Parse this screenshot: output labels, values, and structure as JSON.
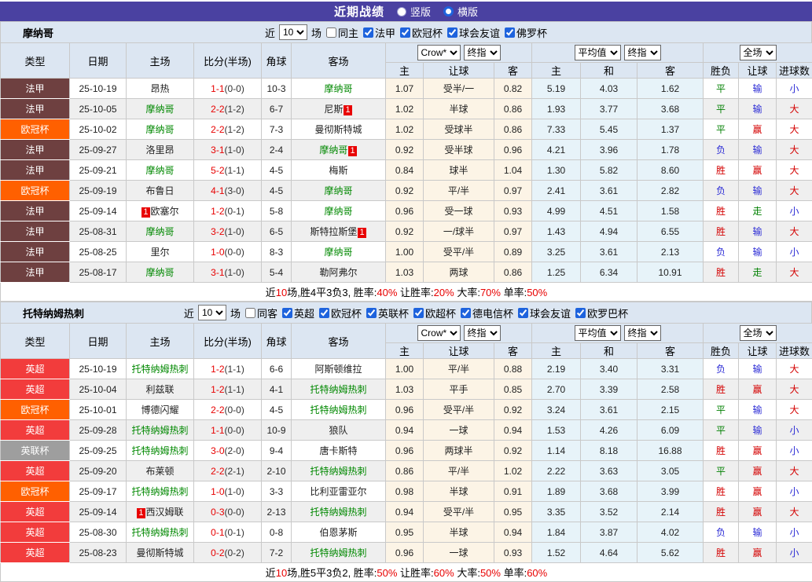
{
  "topbar": {
    "title": "近期战绩",
    "radio_vertical": "竖版",
    "radio_horizontal": "横版",
    "selected": "横版"
  },
  "table_headers": {
    "static": [
      "类型",
      "日期",
      "主场",
      "比分(半场)",
      "角球",
      "客场"
    ],
    "crow_select": "Crow*",
    "final_select": "终指",
    "avg_select": "平均值",
    "full_select": "全场",
    "sub": [
      "主",
      "让球",
      "客",
      "主",
      "和",
      "客",
      "胜负",
      "让球",
      "进球数"
    ]
  },
  "colors": {
    "topbar_bg": "#4a41a1",
    "panel_bg": "#dce6f2",
    "crow_bg": "#fcf4e6",
    "avg_bg": "#e7f3f9",
    "stripe_bg": "#efefef",
    "team_green": "#008800",
    "score_red": "#e80000",
    "badge_red": "#e80000",
    "stat_red": "#e80000",
    "league_colors": {
      "法甲": "#6e4040",
      "欧冠杯": "#ff6000",
      "英超": "#f23c3c",
      "英联杯": "#9e9e9e"
    }
  },
  "result_colors": {
    "胜": "#d40000",
    "平": "#008000",
    "负": "#2b2bd5",
    "赢": "#d40000",
    "走": "#008000",
    "输": "#2b2bd5",
    "大": "#d40000",
    "小": "#2b2bd5"
  },
  "sections": [
    {
      "team": "摩纳哥",
      "filter": {
        "near": "近",
        "count": "10",
        "suffix": "场",
        "same_label": "同主",
        "same_checked": false,
        "leagues": [
          "法甲",
          "欧冠杯",
          "球会友谊",
          "佛罗杯"
        ]
      },
      "rows": [
        {
          "league": "法甲",
          "date": "25-10-19",
          "home": "昂热",
          "home_green": false,
          "home_badge": null,
          "score": "1-1",
          "half": "(0-0)",
          "corner": "10-3",
          "away": "摩纳哥",
          "away_green": true,
          "away_badge": null,
          "crow": [
            "1.07",
            "受半/一",
            "0.82"
          ],
          "avg": [
            "5.19",
            "4.03",
            "1.62"
          ],
          "result": [
            "平",
            "输",
            "小"
          ]
        },
        {
          "league": "法甲",
          "date": "25-10-05",
          "home": "摩纳哥",
          "home_green": true,
          "home_badge": null,
          "score": "2-2",
          "half": "(1-2)",
          "corner": "6-7",
          "away": "尼斯",
          "away_green": false,
          "away_badge": {
            "pos": "after",
            "text": "1"
          },
          "crow": [
            "1.02",
            "半球",
            "0.86"
          ],
          "avg": [
            "1.93",
            "3.77",
            "3.68"
          ],
          "result": [
            "平",
            "输",
            "大"
          ]
        },
        {
          "league": "欧冠杯",
          "date": "25-10-02",
          "home": "摩纳哥",
          "home_green": true,
          "home_badge": null,
          "score": "2-2",
          "half": "(1-2)",
          "corner": "7-3",
          "away": "曼彻斯特城",
          "away_green": false,
          "away_badge": null,
          "crow": [
            "1.02",
            "受球半",
            "0.86"
          ],
          "avg": [
            "7.33",
            "5.45",
            "1.37"
          ],
          "result": [
            "平",
            "赢",
            "大"
          ]
        },
        {
          "league": "法甲",
          "date": "25-09-27",
          "home": "洛里昂",
          "home_green": false,
          "home_badge": null,
          "score": "3-1",
          "half": "(1-0)",
          "corner": "2-4",
          "away": "摩纳哥",
          "away_green": true,
          "away_badge": {
            "pos": "after",
            "text": "1"
          },
          "crow": [
            "0.92",
            "受半球",
            "0.96"
          ],
          "avg": [
            "4.21",
            "3.96",
            "1.78"
          ],
          "result": [
            "负",
            "输",
            "大"
          ]
        },
        {
          "league": "法甲",
          "date": "25-09-21",
          "home": "摩纳哥",
          "home_green": true,
          "home_badge": null,
          "score": "5-2",
          "half": "(1-1)",
          "corner": "4-5",
          "away": "梅斯",
          "away_green": false,
          "away_badge": null,
          "crow": [
            "0.84",
            "球半",
            "1.04"
          ],
          "avg": [
            "1.30",
            "5.82",
            "8.60"
          ],
          "result": [
            "胜",
            "赢",
            "大"
          ]
        },
        {
          "league": "欧冠杯",
          "date": "25-09-19",
          "home": "布鲁日",
          "home_green": false,
          "home_badge": null,
          "score": "4-1",
          "half": "(3-0)",
          "corner": "4-5",
          "away": "摩纳哥",
          "away_green": true,
          "away_badge": null,
          "crow": [
            "0.92",
            "平/半",
            "0.97"
          ],
          "avg": [
            "2.41",
            "3.61",
            "2.82"
          ],
          "result": [
            "负",
            "输",
            "大"
          ]
        },
        {
          "league": "法甲",
          "date": "25-09-14",
          "home": "欧塞尔",
          "home_green": false,
          "home_badge": {
            "pos": "before",
            "text": "1"
          },
          "score": "1-2",
          "half": "(0-1)",
          "corner": "5-8",
          "away": "摩纳哥",
          "away_green": true,
          "away_badge": null,
          "crow": [
            "0.96",
            "受一球",
            "0.93"
          ],
          "avg": [
            "4.99",
            "4.51",
            "1.58"
          ],
          "result": [
            "胜",
            "走",
            "小"
          ]
        },
        {
          "league": "法甲",
          "date": "25-08-31",
          "home": "摩纳哥",
          "home_green": true,
          "home_badge": null,
          "score": "3-2",
          "half": "(1-0)",
          "corner": "6-5",
          "away": "斯特拉斯堡",
          "away_green": false,
          "away_badge": {
            "pos": "after",
            "text": "1"
          },
          "crow": [
            "0.92",
            "一/球半",
            "0.97"
          ],
          "avg": [
            "1.43",
            "4.94",
            "6.55"
          ],
          "result": [
            "胜",
            "输",
            "大"
          ]
        },
        {
          "league": "法甲",
          "date": "25-08-25",
          "home": "里尔",
          "home_green": false,
          "home_badge": null,
          "score": "1-0",
          "half": "(0-0)",
          "corner": "8-3",
          "away": "摩纳哥",
          "away_green": true,
          "away_badge": null,
          "crow": [
            "1.00",
            "受平/半",
            "0.89"
          ],
          "avg": [
            "3.25",
            "3.61",
            "2.13"
          ],
          "result": [
            "负",
            "输",
            "小"
          ]
        },
        {
          "league": "法甲",
          "date": "25-08-17",
          "home": "摩纳哥",
          "home_green": true,
          "home_badge": null,
          "score": "3-1",
          "half": "(1-0)",
          "corner": "5-4",
          "away": "勒阿弗尔",
          "away_green": false,
          "away_badge": null,
          "crow": [
            "1.03",
            "两球",
            "0.86"
          ],
          "avg": [
            "1.25",
            "6.34",
            "10.91"
          ],
          "result": [
            "胜",
            "走",
            "大"
          ]
        }
      ],
      "footer": [
        {
          "t": "近"
        },
        {
          "t": "10",
          "red": true
        },
        {
          "t": "场,胜4平3负3, 胜率:"
        },
        {
          "t": "40%",
          "red": true
        },
        {
          "t": " 让胜率:"
        },
        {
          "t": "20%",
          "red": true
        },
        {
          "t": " 大率:"
        },
        {
          "t": "70%",
          "red": true
        },
        {
          "t": " 单率:"
        },
        {
          "t": "50%",
          "red": true
        }
      ]
    },
    {
      "team": "托特纳姆热刺",
      "filter": {
        "near": "近",
        "count": "10",
        "suffix": "场",
        "same_label": "同客",
        "same_checked": false,
        "leagues": [
          "英超",
          "欧冠杯",
          "英联杯",
          "欧超杯",
          "德电信杯",
          "球会友谊",
          "欧罗巴杯"
        ]
      },
      "rows": [
        {
          "league": "英超",
          "date": "25-10-19",
          "home": "托特纳姆热刺",
          "home_green": true,
          "home_badge": null,
          "score": "1-2",
          "half": "(1-1)",
          "corner": "6-6",
          "away": "阿斯顿维拉",
          "away_green": false,
          "away_badge": null,
          "crow": [
            "1.00",
            "平/半",
            "0.88"
          ],
          "avg": [
            "2.19",
            "3.40",
            "3.31"
          ],
          "result": [
            "负",
            "输",
            "大"
          ]
        },
        {
          "league": "英超",
          "date": "25-10-04",
          "home": "利兹联",
          "home_green": false,
          "home_badge": null,
          "score": "1-2",
          "half": "(1-1)",
          "corner": "4-1",
          "away": "托特纳姆热刺",
          "away_green": true,
          "away_badge": null,
          "crow": [
            "1.03",
            "平手",
            "0.85"
          ],
          "avg": [
            "2.70",
            "3.39",
            "2.58"
          ],
          "result": [
            "胜",
            "赢",
            "大"
          ]
        },
        {
          "league": "欧冠杯",
          "date": "25-10-01",
          "home": "博德闪耀",
          "home_green": false,
          "home_badge": null,
          "score": "2-2",
          "half": "(0-0)",
          "corner": "4-5",
          "away": "托特纳姆热刺",
          "away_green": true,
          "away_badge": null,
          "crow": [
            "0.96",
            "受平/半",
            "0.92"
          ],
          "avg": [
            "3.24",
            "3.61",
            "2.15"
          ],
          "result": [
            "平",
            "输",
            "大"
          ]
        },
        {
          "league": "英超",
          "date": "25-09-28",
          "home": "托特纳姆热刺",
          "home_green": true,
          "home_badge": null,
          "score": "1-1",
          "half": "(0-0)",
          "corner": "10-9",
          "away": "狼队",
          "away_green": false,
          "away_badge": null,
          "crow": [
            "0.94",
            "一球",
            "0.94"
          ],
          "avg": [
            "1.53",
            "4.26",
            "6.09"
          ],
          "result": [
            "平",
            "输",
            "小"
          ]
        },
        {
          "league": "英联杯",
          "date": "25-09-25",
          "home": "托特纳姆热刺",
          "home_green": true,
          "home_badge": null,
          "score": "3-0",
          "half": "(2-0)",
          "corner": "9-4",
          "away": "唐卡斯特",
          "away_green": false,
          "away_badge": null,
          "crow": [
            "0.96",
            "两球半",
            "0.92"
          ],
          "avg": [
            "1.14",
            "8.18",
            "16.88"
          ],
          "result": [
            "胜",
            "赢",
            "小"
          ]
        },
        {
          "league": "英超",
          "date": "25-09-20",
          "home": "布莱顿",
          "home_green": false,
          "home_badge": null,
          "score": "2-2",
          "half": "(2-1)",
          "corner": "2-10",
          "away": "托特纳姆热刺",
          "away_green": true,
          "away_badge": null,
          "crow": [
            "0.86",
            "平/半",
            "1.02"
          ],
          "avg": [
            "2.22",
            "3.63",
            "3.05"
          ],
          "result": [
            "平",
            "赢",
            "大"
          ]
        },
        {
          "league": "欧冠杯",
          "date": "25-09-17",
          "home": "托特纳姆热刺",
          "home_green": true,
          "home_badge": null,
          "score": "1-0",
          "half": "(1-0)",
          "corner": "3-3",
          "away": "比利亚雷亚尔",
          "away_green": false,
          "away_badge": null,
          "crow": [
            "0.98",
            "半球",
            "0.91"
          ],
          "avg": [
            "1.89",
            "3.68",
            "3.99"
          ],
          "result": [
            "胜",
            "赢",
            "小"
          ]
        },
        {
          "league": "英超",
          "date": "25-09-14",
          "home": "西汉姆联",
          "home_green": false,
          "home_badge": {
            "pos": "before",
            "text": "1"
          },
          "score": "0-3",
          "half": "(0-0)",
          "corner": "2-13",
          "away": "托特纳姆热刺",
          "away_green": true,
          "away_badge": null,
          "crow": [
            "0.94",
            "受平/半",
            "0.95"
          ],
          "avg": [
            "3.35",
            "3.52",
            "2.14"
          ],
          "result": [
            "胜",
            "赢",
            "大"
          ]
        },
        {
          "league": "英超",
          "date": "25-08-30",
          "home": "托特纳姆热刺",
          "home_green": true,
          "home_badge": null,
          "score": "0-1",
          "half": "(0-1)",
          "corner": "0-8",
          "away": "伯恩茅斯",
          "away_green": false,
          "away_badge": null,
          "crow": [
            "0.95",
            "半球",
            "0.94"
          ],
          "avg": [
            "1.84",
            "3.87",
            "4.02"
          ],
          "result": [
            "负",
            "输",
            "小"
          ]
        },
        {
          "league": "英超",
          "date": "25-08-23",
          "home": "曼彻斯特城",
          "home_green": false,
          "home_badge": null,
          "score": "0-2",
          "half": "(0-2)",
          "corner": "7-2",
          "away": "托特纳姆热刺",
          "away_green": true,
          "away_badge": null,
          "crow": [
            "0.96",
            "一球",
            "0.93"
          ],
          "avg": [
            "1.52",
            "4.64",
            "5.62"
          ],
          "result": [
            "胜",
            "赢",
            "小"
          ]
        }
      ],
      "footer": [
        {
          "t": "近"
        },
        {
          "t": "10",
          "red": true
        },
        {
          "t": "场,胜5平3负2, 胜率:"
        },
        {
          "t": "50%",
          "red": true
        },
        {
          "t": " 让胜率:"
        },
        {
          "t": "60%",
          "red": true
        },
        {
          "t": " 大率:"
        },
        {
          "t": "50%",
          "red": true
        },
        {
          "t": " 单率:"
        },
        {
          "t": "60%",
          "red": true
        }
      ]
    }
  ]
}
